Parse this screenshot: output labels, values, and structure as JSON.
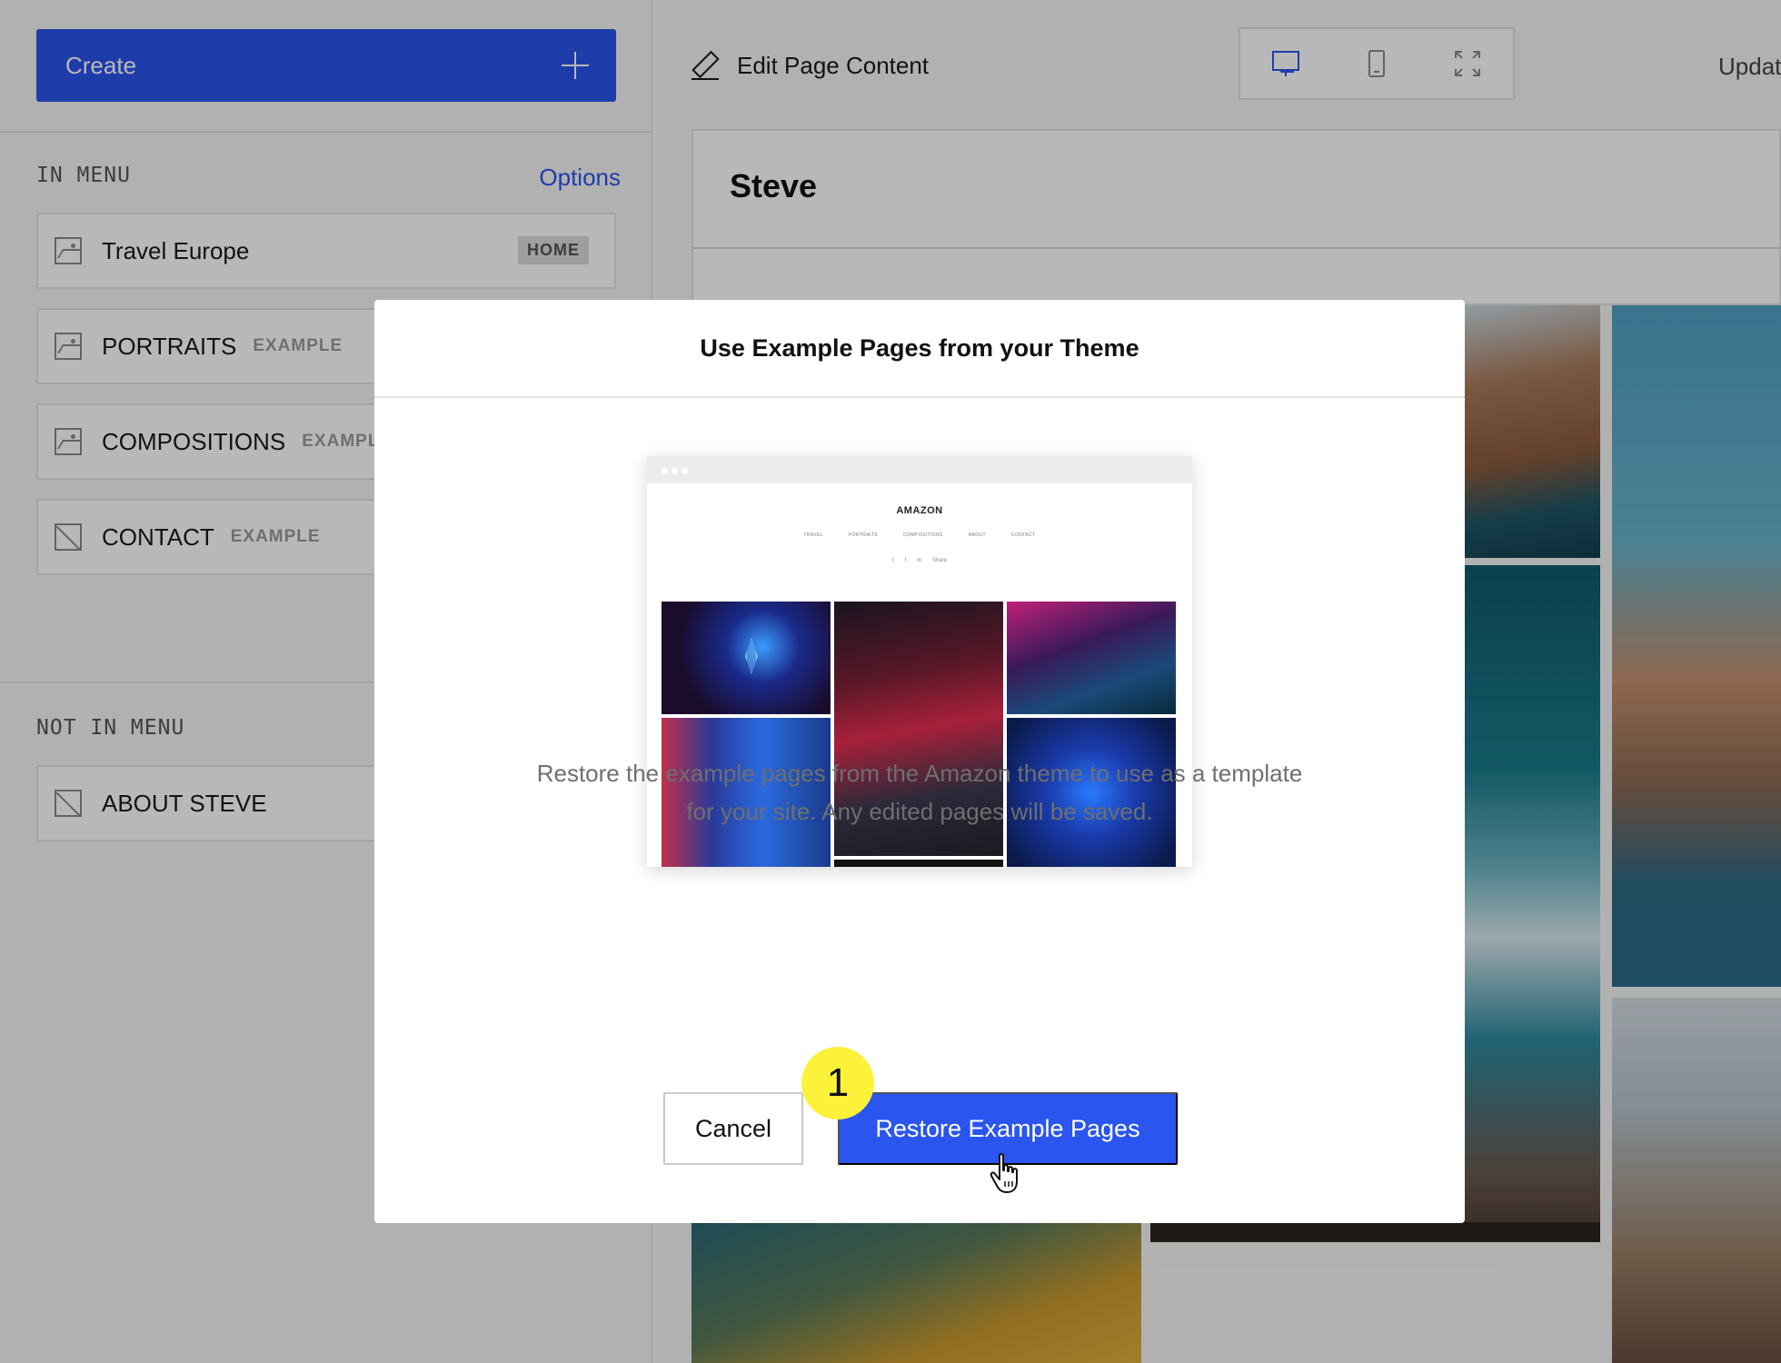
{
  "sidebar": {
    "create_label": "Create",
    "in_menu_label": "IN MENU",
    "options_label": "Options",
    "in_menu_items": [
      {
        "title": "Travel Europe",
        "badge": "HOME",
        "icon": "image-icon"
      },
      {
        "title": "PORTRAITS",
        "tag": "EXAMPLE",
        "icon": "image-icon"
      },
      {
        "title": "COMPOSITIONS",
        "tag": "EXAMPLE",
        "icon": "image-icon"
      },
      {
        "title": "CONTACT",
        "tag": "EXAMPLE",
        "icon": "blank-page-icon"
      }
    ],
    "not_in_menu_label": "NOT IN MENU",
    "not_in_menu_items": [
      {
        "title": "ABOUT STEVE",
        "icon": "blank-page-icon"
      }
    ]
  },
  "toolbar": {
    "edit_label": "Edit Page Content",
    "update_label": "Updat",
    "view_modes": [
      "desktop-icon",
      "mobile-icon",
      "expand-icon"
    ],
    "active_color": "#2a55ee"
  },
  "site": {
    "name": "Steve"
  },
  "modal": {
    "title": "Use Example Pages from your Theme",
    "preview": {
      "brand": "AMAZON",
      "nav": [
        "TRAVEL",
        "PORTRAITS",
        "COMPOSITIONS",
        "ABOUT",
        "CONTACT"
      ],
      "social": [
        "t",
        "f",
        "in",
        "Share"
      ]
    },
    "description_line1": "Restore the example pages from the Amazon theme to use as a template",
    "description_line2": "for your site. Any edited pages will be saved.",
    "cancel_label": "Cancel",
    "restore_label": "Restore Example Pages",
    "step_number": "1",
    "primary_color": "#2a55ee",
    "badge_color": "#fdf23a"
  }
}
